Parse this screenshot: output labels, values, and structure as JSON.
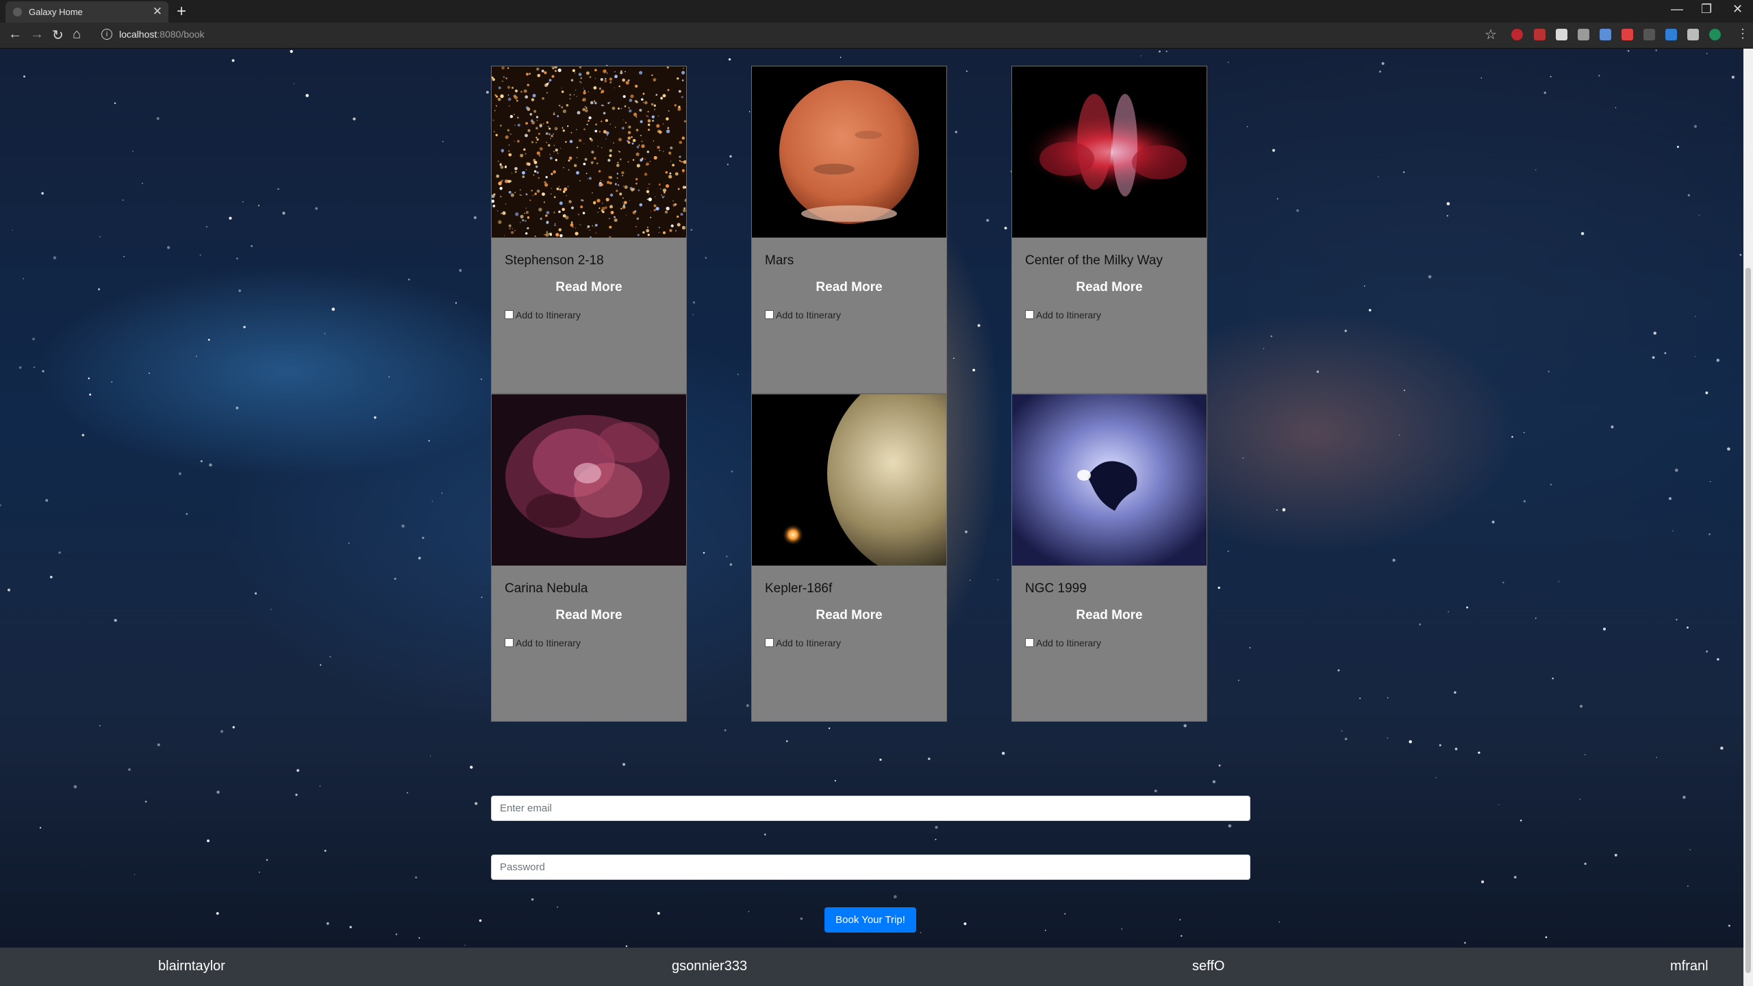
{
  "browser": {
    "tab_title": "Galaxy Home",
    "url_host": "localhost",
    "url_rest": ":8080/book",
    "new_tab_label": "+",
    "close_label": "✕"
  },
  "cards": [
    {
      "name": "Stephenson 2-18",
      "read_more": "Read More",
      "checkbox_label": "Add to Itinerary",
      "checked": false
    },
    {
      "name": "Mars",
      "read_more": "Read More",
      "checkbox_label": "Add to Itinerary",
      "checked": false
    },
    {
      "name": "Center of the Milky Way",
      "read_more": "Read More",
      "checkbox_label": "Add to Itinerary",
      "checked": false
    },
    {
      "name": "Carina Nebula",
      "read_more": "Read More",
      "checkbox_label": "Add to Itinerary",
      "checked": false
    },
    {
      "name": "Kepler-186f",
      "read_more": "Read More",
      "checkbox_label": "Add to Itinerary",
      "checked": false
    },
    {
      "name": "NGC 1999",
      "read_more": "Read More",
      "checkbox_label": "Add to Itinerary",
      "checked": false
    }
  ],
  "form": {
    "email_placeholder": "Enter email",
    "password_placeholder": "Password",
    "submit_label": "Book Your Trip!"
  },
  "footer": {
    "names": [
      "blairntaylor",
      "gsonnier333",
      "seffO",
      "mfranl"
    ]
  },
  "colors": {
    "card_bg": "#808080",
    "button_primary": "#007bff",
    "footer_bg": "#343a40"
  }
}
